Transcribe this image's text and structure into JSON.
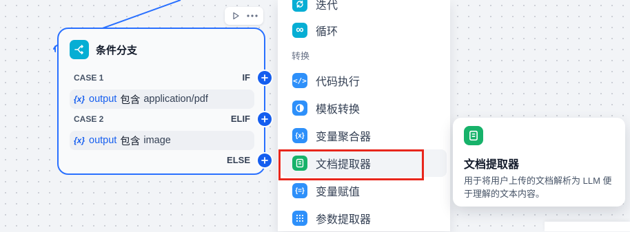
{
  "node": {
    "title": "条件分支",
    "title_icon": "branch-icon",
    "accent": "#2970ff",
    "cases": [
      {
        "case_label": "CASE 1",
        "branch": "IF",
        "condition": {
          "var_icon": "{x}",
          "variable": "output",
          "operator": "包含",
          "value": "application/pdf"
        }
      },
      {
        "case_label": "CASE 2",
        "branch": "ELIF",
        "condition": {
          "var_icon": "{x}",
          "variable": "output",
          "operator": "包含",
          "value": "image"
        }
      }
    ],
    "else_label": "ELSE"
  },
  "menu": {
    "items_top": [
      {
        "label": "迭代",
        "icon": "iteration-icon",
        "color": "#06aed4"
      },
      {
        "label": "循环",
        "icon": "loop-icon",
        "color": "#06aed4"
      }
    ],
    "section": "转换",
    "items": [
      {
        "label": "代码执行",
        "icon": "code-icon",
        "color": "#2e90fa"
      },
      {
        "label": "模板转换",
        "icon": "template-icon",
        "color": "#2e90fa"
      },
      {
        "label": "变量聚合器",
        "icon": "variable-aggregator-icon",
        "color": "#2e90fa"
      },
      {
        "label": "文档提取器",
        "icon": "document-extractor-icon",
        "color": "#17b26a"
      },
      {
        "label": "变量赋值",
        "icon": "variable-assigner-icon",
        "color": "#2e90fa"
      },
      {
        "label": "参数提取器",
        "icon": "parameter-extractor-icon",
        "color": "#2e90fa"
      }
    ]
  },
  "tooltip": {
    "title": "文档提取器",
    "description": "用于将用户上传的文档解析为 LLM 便于理解的文本内容。",
    "icon": "document-extractor-icon",
    "color": "#17b26a"
  }
}
